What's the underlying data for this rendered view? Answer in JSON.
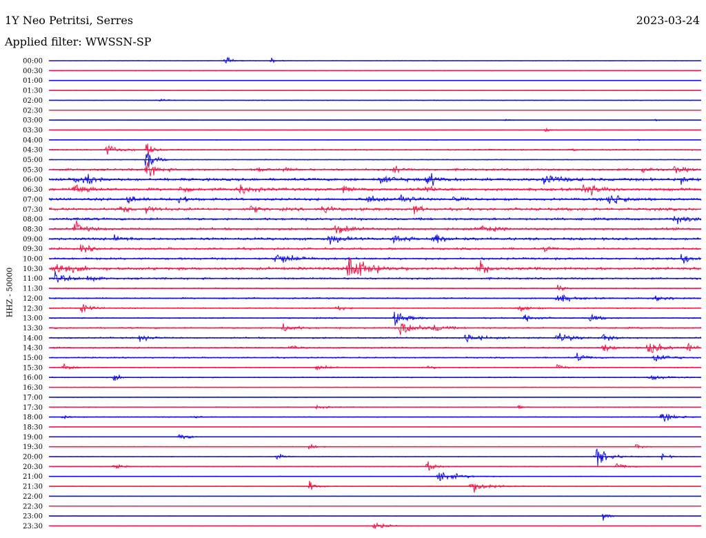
{
  "header": {
    "station": "1Y Neo Petritsi, Serres",
    "date": "2023-03-24",
    "filter": "Applied filter: WWSSN-SP"
  },
  "chart_data": {
    "type": "line",
    "title": "1Y Neo Petritsi, Serres",
    "ylabel": "HHZ - 50000",
    "colors": {
      "even": "#1010e0",
      "odd": "#ee1a4a"
    },
    "row_labels": [
      "00:00",
      "00:30",
      "01:00",
      "01:30",
      "02:00",
      "02:30",
      "03:00",
      "03:30",
      "04:00",
      "04:30",
      "05:00",
      "05:30",
      "06:00",
      "06:30",
      "07:00",
      "07:30",
      "08:00",
      "08:30",
      "09:00",
      "09:30",
      "10:00",
      "10:30",
      "11:00",
      "11:30",
      "12:00",
      "12:30",
      "13:00",
      "13:30",
      "14:00",
      "14:30",
      "15:00",
      "15:30",
      "16:00",
      "16:30",
      "17:00",
      "17:30",
      "18:00",
      "18:30",
      "19:00",
      "19:30",
      "20:00",
      "20:30",
      "21:00",
      "21:30",
      "22:00",
      "22:30",
      "23:00",
      "23:30"
    ],
    "noise_levels": [
      0.4,
      0.6,
      0.3,
      0.6,
      0.7,
      0.3,
      0.4,
      0.5,
      0.6,
      1.2,
      0.8,
      2.0,
      2.6,
      2.6,
      2.4,
      2.6,
      2.2,
      2.2,
      2.4,
      2.0,
      2.0,
      2.6,
      1.8,
      1.2,
      1.4,
      1.2,
      1.2,
      1.4,
      1.4,
      1.4,
      1.2,
      1.0,
      1.0,
      0.6,
      0.6,
      0.8,
      0.8,
      0.4,
      0.5,
      0.6,
      0.7,
      0.8,
      0.6,
      0.6,
      0.4,
      0.5,
      0.5,
      0.4
    ],
    "events": [
      [
        [
          0.27,
          7,
          1.2
        ],
        [
          0.34,
          8,
          1.0
        ]
      ],
      [],
      [],
      [],
      [
        [
          0.17,
          3,
          1.5
        ]
      ],
      [],
      [
        [
          0.7,
          2,
          1.0
        ],
        [
          0.93,
          2,
          0.8
        ]
      ],
      [
        [
          0.76,
          4,
          1.0
        ]
      ],
      [
        [
          0.9,
          2,
          1.0
        ]
      ],
      [
        [
          0.09,
          10,
          2.0
        ],
        [
          0.15,
          16,
          1.0
        ],
        [
          0.8,
          3,
          1.0
        ]
      ],
      [
        [
          0.15,
          20,
          1.5
        ]
      ],
      [
        [
          0.15,
          18,
          1.5
        ],
        [
          0.32,
          5,
          1.0
        ],
        [
          0.36,
          5,
          1.0
        ],
        [
          0.53,
          7,
          1.5
        ],
        [
          0.91,
          8,
          1.0
        ],
        [
          0.96,
          8,
          1.5
        ]
      ],
      [
        [
          0.04,
          12,
          1.5
        ],
        [
          0.06,
          8,
          1.0
        ],
        [
          0.51,
          11,
          2.0
        ],
        [
          0.58,
          17,
          1.5
        ],
        [
          0.76,
          14,
          2.0
        ],
        [
          0.97,
          9,
          1.0
        ]
      ],
      [
        [
          0.04,
          20,
          1.5
        ],
        [
          0.2,
          8,
          1.0
        ],
        [
          0.29,
          12,
          2.0
        ],
        [
          0.45,
          10,
          1.0
        ],
        [
          0.57,
          9,
          1.5
        ],
        [
          0.82,
          15,
          2.0
        ]
      ],
      [
        [
          0.12,
          14,
          1.0
        ],
        [
          0.2,
          12,
          1.0
        ],
        [
          0.49,
          12,
          1.5
        ],
        [
          0.54,
          12,
          1.5
        ],
        [
          0.62,
          8,
          1.0
        ],
        [
          0.86,
          15,
          2.0
        ]
      ],
      [
        [
          0.11,
          10,
          1.0
        ],
        [
          0.15,
          12,
          1.0
        ],
        [
          0.31,
          8,
          1.0
        ],
        [
          0.42,
          9,
          1.5
        ],
        [
          0.56,
          10,
          1.0
        ]
      ],
      [
        [
          0.04,
          6,
          1.0
        ],
        [
          0.96,
          10,
          2.0
        ]
      ],
      [
        [
          0.04,
          14,
          1.5
        ],
        [
          0.44,
          11,
          2.0
        ],
        [
          0.66,
          10,
          2.0
        ]
      ],
      [
        [
          0.1,
          8,
          1.5
        ],
        [
          0.43,
          10,
          2.0
        ],
        [
          0.53,
          14,
          1.5
        ],
        [
          0.59,
          12,
          2.0
        ]
      ],
      [
        [
          0.05,
          8,
          1.5
        ],
        [
          0.76,
          8,
          1.0
        ]
      ],
      [
        [
          0.35,
          12,
          3.0
        ],
        [
          0.97,
          12,
          1.5
        ]
      ],
      [
        [
          0.01,
          12,
          3.0
        ],
        [
          0.46,
          30,
          3.0
        ],
        [
          0.66,
          15,
          1.5
        ]
      ],
      [
        [
          0.01,
          10,
          2.0
        ],
        [
          0.06,
          8,
          1.0
        ]
      ],
      [
        [
          0.78,
          8,
          1.0
        ]
      ],
      [
        [
          0.78,
          10,
          2.0
        ],
        [
          0.93,
          8,
          2.0
        ]
      ],
      [
        [
          0.05,
          10,
          1.5
        ],
        [
          0.44,
          8,
          1.0
        ],
        [
          0.72,
          8,
          1.5
        ]
      ],
      [
        [
          0.53,
          14,
          2.0
        ],
        [
          0.73,
          10,
          1.5
        ],
        [
          0.83,
          8,
          1.5
        ]
      ],
      [
        [
          0.36,
          10,
          1.5
        ],
        [
          0.54,
          20,
          2.0
        ],
        [
          0.59,
          10,
          1.5
        ]
      ],
      [
        [
          0.14,
          8,
          1.5
        ],
        [
          0.64,
          12,
          2.0
        ],
        [
          0.78,
          12,
          2.0
        ],
        [
          0.85,
          10,
          1.5
        ]
      ],
      [
        [
          0.37,
          5,
          1.0
        ],
        [
          0.85,
          8,
          1.5
        ],
        [
          0.92,
          15,
          2.0
        ],
        [
          0.98,
          10,
          1.5
        ]
      ],
      [
        [
          0.81,
          10,
          1.5
        ],
        [
          0.93,
          12,
          2.0
        ]
      ],
      [
        [
          0.02,
          8,
          1.5
        ],
        [
          0.41,
          6,
          2.0
        ],
        [
          0.58,
          5,
          1.0
        ],
        [
          0.78,
          6,
          1.0
        ]
      ],
      [
        [
          0.1,
          8,
          1.0
        ],
        [
          0.92,
          8,
          2.5
        ]
      ],
      [],
      [],
      [
        [
          0.41,
          5,
          1.5
        ],
        [
          0.72,
          5,
          1.0
        ]
      ],
      [
        [
          0.02,
          5,
          1.0
        ],
        [
          0.22,
          5,
          1.0
        ],
        [
          0.94,
          8,
          2.5
        ]
      ],
      [],
      [
        [
          0.2,
          8,
          1.5
        ]
      ],
      [
        [
          0.4,
          10,
          1.0
        ],
        [
          0.9,
          8,
          1.0
        ]
      ],
      [
        [
          0.35,
          8,
          1.0
        ],
        [
          0.84,
          20,
          2.0
        ],
        [
          0.94,
          8,
          1.0
        ]
      ],
      [
        [
          0.1,
          8,
          1.0
        ],
        [
          0.58,
          10,
          1.5
        ],
        [
          0.87,
          8,
          1.5
        ]
      ],
      [
        [
          0.6,
          12,
          3.0
        ]
      ],
      [
        [
          0.4,
          14,
          1.0
        ],
        [
          0.65,
          12,
          3.0
        ]
      ],
      [],
      [],
      [
        [
          0.85,
          10,
          1.0
        ]
      ],
      [
        [
          0.5,
          8,
          2.0
        ]
      ]
    ]
  }
}
